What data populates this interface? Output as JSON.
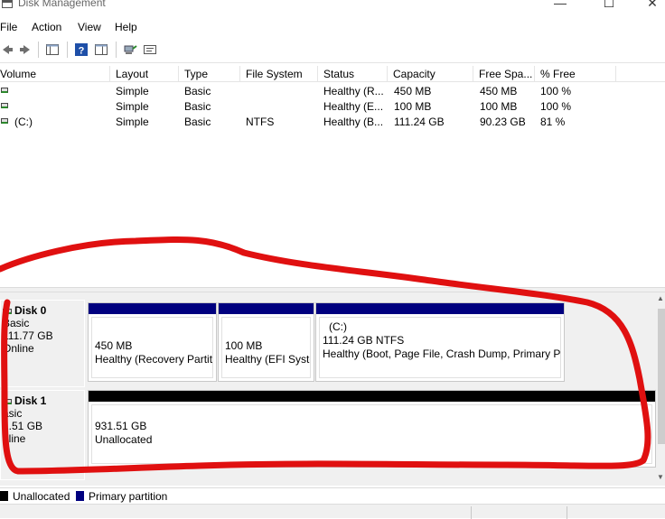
{
  "window": {
    "title": "Disk Management",
    "minimize": "—",
    "maximize": "☐",
    "close": "✕"
  },
  "menu": [
    "File",
    "Action",
    "View",
    "Help"
  ],
  "toolbar": {
    "icons": [
      "back-arrow-icon",
      "forward-arrow-icon",
      "console-tree-icon",
      "help-icon",
      "properties-icon",
      "connect-icon",
      "settings-icon"
    ]
  },
  "volume_table": {
    "columns": [
      "Volume",
      "Layout",
      "Type",
      "File System",
      "Status",
      "Capacity",
      "Free Spa...",
      "% Free"
    ],
    "rows": [
      {
        "volume": "",
        "layout": "Simple",
        "type": "Basic",
        "fs": "",
        "status": "Healthy (R...",
        "capacity": "450 MB",
        "free": "450 MB",
        "pct": "100 %"
      },
      {
        "volume": "",
        "layout": "Simple",
        "type": "Basic",
        "fs": "",
        "status": "Healthy (E...",
        "capacity": "100 MB",
        "free": "100 MB",
        "pct": "100 %"
      },
      {
        "volume": "(C:)",
        "layout": "Simple",
        "type": "Basic",
        "fs": "NTFS",
        "status": "Healthy (B...",
        "capacity": "111.24 GB",
        "free": "90.23 GB",
        "pct": "81 %"
      }
    ]
  },
  "disks": [
    {
      "name": "Disk 0",
      "type": "Basic",
      "size": "111.77 GB",
      "state": "Online",
      "partitions": [
        {
          "title": "",
          "size": "450 MB",
          "status": "Healthy (Recovery Partit"
        },
        {
          "title": "",
          "size": "100 MB",
          "status": "Healthy (EFI Syste"
        },
        {
          "title": "(C:)",
          "size": "111.24 GB NTFS",
          "status": "Healthy (Boot, Page File, Crash Dump, Primary Pa"
        }
      ]
    },
    {
      "name": "Disk 1",
      "type": "asic",
      "size": "1.51 GB",
      "state": "nline",
      "partitions": [
        {
          "title": "",
          "size": "931.51 GB",
          "status": "Unallocated"
        }
      ]
    }
  ],
  "legend": [
    {
      "label": "Unallocated",
      "color": "#000000"
    },
    {
      "label": "Primary partition",
      "color": "#00007f"
    }
  ],
  "colors": {
    "primary_bar": "#00007f",
    "unallocated_bar": "#000000",
    "annotation": "#e01010"
  }
}
